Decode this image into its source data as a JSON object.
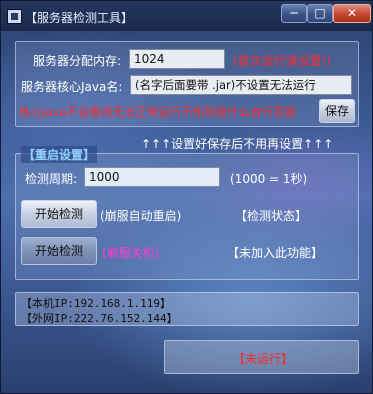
{
  "window": {
    "title": "【服务器检测工具】",
    "minimize_glyph": "─",
    "maximize_glyph": "□",
    "close_glyph": "✕"
  },
  "config": {
    "memory_label": "服务器分配内存:",
    "memory_value": "1024",
    "memory_hint": "(首次运行请设置!)",
    "java_label": "服务器核心Java名:",
    "java_value": "(名字后面要带 .jar)不设置无法运行",
    "warning": "核心Java不设置则无法正常运行不知到是什么自行百度",
    "save_label": "保存",
    "save_note": "↑↑↑设置好保存后不用再设置↑↑↑"
  },
  "restart": {
    "group_title": "【重启设置】",
    "period_label": "检测周期:",
    "period_value": "1000",
    "period_note": "(1000 = 1秒)",
    "check_button": "开始检测",
    "auto_restart_note": "(崩服自动重启)",
    "detect_status": "【检测状态】",
    "shutdown_button": "开始检测",
    "shutdown_note": "(崩服关机)",
    "not_added": "【未加入此功能】"
  },
  "network": {
    "local_ip": "【本机IP:192.168.1.119】",
    "public_ip": "【外网IP:222.76.152.144】"
  },
  "status": {
    "run_state": "【未运行】"
  }
}
